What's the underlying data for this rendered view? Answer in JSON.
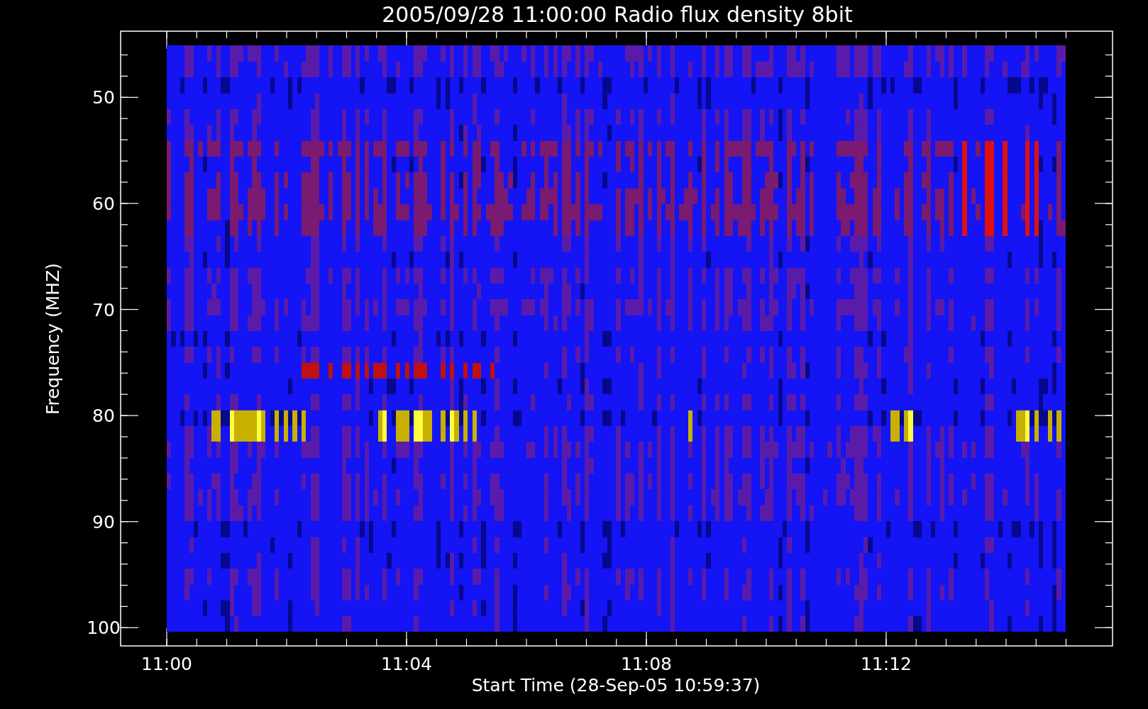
{
  "plot": {
    "title": "2005/09/28 11:00:00 Radio flux density 8bit",
    "ylabel": "Frequency (MHZ)",
    "xlabel": "Start Time (28-Sep-05 10:59:37)",
    "yticks": [
      "50",
      "60",
      "70",
      "80",
      "90",
      "100"
    ],
    "xticks": [
      "11:00",
      "11:04",
      "11:08",
      "11:12"
    ]
  }
}
